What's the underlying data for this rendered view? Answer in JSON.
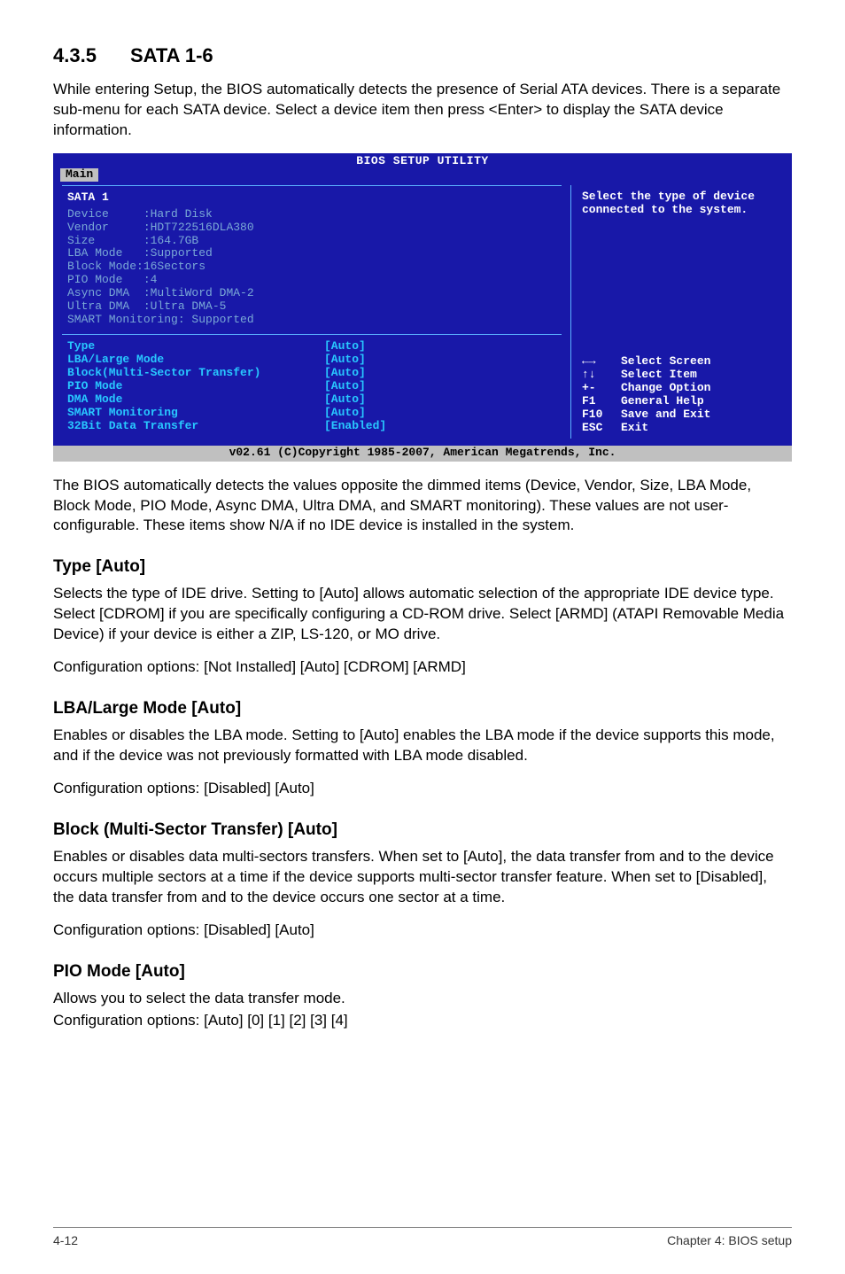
{
  "section": {
    "number": "4.3.5",
    "title": "SATA 1-6"
  },
  "intro": "While entering Setup, the BIOS automatically detects the presence of Serial ATA devices. There is a separate sub-menu for each SATA device. Select a device item then press <Enter> to display the SATA device information.",
  "bios": {
    "title": "BIOS SETUP UTILITY",
    "active_tab": "Main",
    "panel_title": "SATA 1",
    "dim_items": [
      {
        "label": "Device",
        "value": ":Hard Disk"
      },
      {
        "label": "Vendor",
        "value": ":HDT722516DLA380"
      },
      {
        "label": "Size",
        "value": ":164.7GB"
      },
      {
        "label": "LBA Mode",
        "value": ":Supported"
      },
      {
        "label": "Block Mode",
        "value": ":16Sectors"
      },
      {
        "label": "PIO Mode",
        "value": ":4"
      },
      {
        "label": "Async DMA",
        "value": ":MultiWord DMA-2"
      },
      {
        "label": "Ultra DMA",
        "value": ":Ultra DMA-5"
      },
      {
        "label": "SMART Monitoring",
        "value": ": Supported"
      }
    ],
    "options": [
      {
        "label": "Type",
        "value": "[Auto]"
      },
      {
        "label": "LBA/Large Mode",
        "value": "[Auto]"
      },
      {
        "label": "Block(Multi-Sector Transfer)",
        "value": "[Auto]"
      },
      {
        "label": "PIO Mode",
        "value": "[Auto]"
      },
      {
        "label": "DMA Mode",
        "value": "[Auto]"
      },
      {
        "label": "SMART Monitoring",
        "value": "[Auto]"
      },
      {
        "label": "32Bit Data Transfer",
        "value": "[Enabled]"
      }
    ],
    "help_text": "Select the type of device connected to the system.",
    "keys": [
      {
        "icon": "←→",
        "text": "Select Screen"
      },
      {
        "icon": "↑↓",
        "text": "Select Item"
      },
      {
        "icon": "+-",
        "text": "Change Option"
      },
      {
        "icon": "F1",
        "text": "General Help"
      },
      {
        "icon": "F10",
        "text": "Save and Exit"
      },
      {
        "icon": "ESC",
        "text": "Exit"
      }
    ],
    "footer": "v02.61 (C)Copyright 1985-2007, American Megatrends, Inc."
  },
  "after_bios": "The BIOS automatically detects the values opposite the dimmed items (Device, Vendor, Size, LBA Mode, Block Mode, PIO Mode, Async DMA, Ultra DMA, and SMART monitoring). These values are not user-configurable. These items show N/A if no IDE device is installed in the system.",
  "type": {
    "heading": "Type [Auto]",
    "p1": "Selects the type of IDE drive. Setting to [Auto] allows automatic selection of the appropriate IDE device type. Select [CDROM] if you are specifically configuring a CD-ROM drive. Select [ARMD] (ATAPI Removable Media Device) if your device is either a ZIP, LS-120, or MO drive.",
    "p2": "Configuration options: [Not Installed] [Auto] [CDROM] [ARMD]"
  },
  "lba": {
    "heading": "LBA/Large Mode [Auto]",
    "p1": "Enables or disables the LBA mode. Setting to [Auto] enables the LBA mode if the device supports this mode, and if the device was not previously formatted with LBA mode disabled.",
    "p2": "Configuration options: [Disabled] [Auto]"
  },
  "block": {
    "heading": "Block (Multi-Sector Transfer) [Auto]",
    "p1": "Enables or disables data multi-sectors transfers. When set to [Auto], the data transfer from and to the device occurs multiple sectors at a time if the device supports multi-sector transfer feature. When set to [Disabled], the data transfer from and to the device occurs one sector at a time.",
    "p2": "Configuration options: [Disabled] [Auto]"
  },
  "pio": {
    "heading": "PIO Mode [Auto]",
    "p1": "Allows you to select the data transfer mode.",
    "p2": "Configuration options: [Auto] [0] [1] [2] [3] [4]"
  },
  "footer": {
    "left": "4-12",
    "right": "Chapter 4: BIOS setup"
  }
}
